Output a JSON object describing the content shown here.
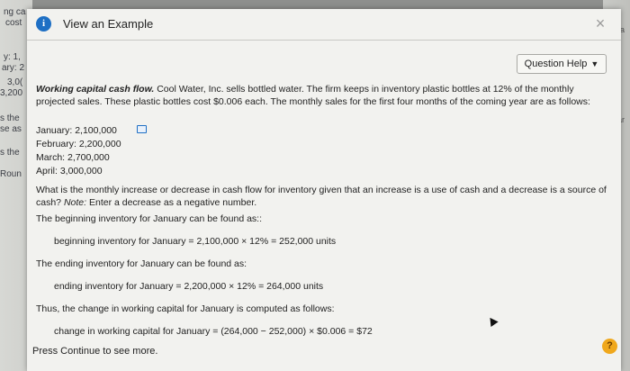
{
  "background": {
    "left_fragments": [
      "ng ca",
      "cost",
      "y: 1,",
      "ary: 2",
      "3,0(",
      "3,200",
      "s the",
      "se as",
      "s the",
      "Roun"
    ],
    "right_fragments": [
      "pla",
      "ar"
    ]
  },
  "modal": {
    "title": "View an Example",
    "info_icon": "i",
    "close_icon": "×",
    "question_help": "Question Help",
    "problem": {
      "lead": "Working capital cash flow.",
      "text": "Cool Water, Inc. sells bottled water. The firm keeps in inventory plastic bottles at 12% of the monthly projected sales. These plastic bottles cost $0.006 each. The monthly sales for the first four months of the coming year are as follows:"
    },
    "sales": [
      {
        "label": "January: 2,100,000"
      },
      {
        "label": "February: 2,200,000"
      },
      {
        "label": "March: 2,700,000"
      },
      {
        "label": "April: 3,000,000"
      }
    ],
    "question": {
      "text": "What is the monthly increase or decrease in cash flow for inventory given that an increase is a use of cash and a decrease is a source of cash?",
      "note_label": "Note:",
      "note_text": "Enter a decrease as a negative number."
    },
    "steps": [
      {
        "text": "The beginning inventory for January can be found as::",
        "indent": false
      },
      {
        "text": "beginning inventory for January = 2,100,000 × 12% = 252,000 units",
        "indent": true
      },
      {
        "text": "The ending inventory for January can be found as:",
        "indent": false
      },
      {
        "text": "ending inventory for January = 2,200,000 × 12% = 264,000 units",
        "indent": true
      },
      {
        "text": "Thus, the change in working capital for January is computed as follows:",
        "indent": false
      },
      {
        "text": "change in working capital for January = (264,000 − 252,000) × $0.006 = $72",
        "indent": true
      }
    ],
    "continue_text": "Press Continue to see more.",
    "help_icon": "?"
  }
}
